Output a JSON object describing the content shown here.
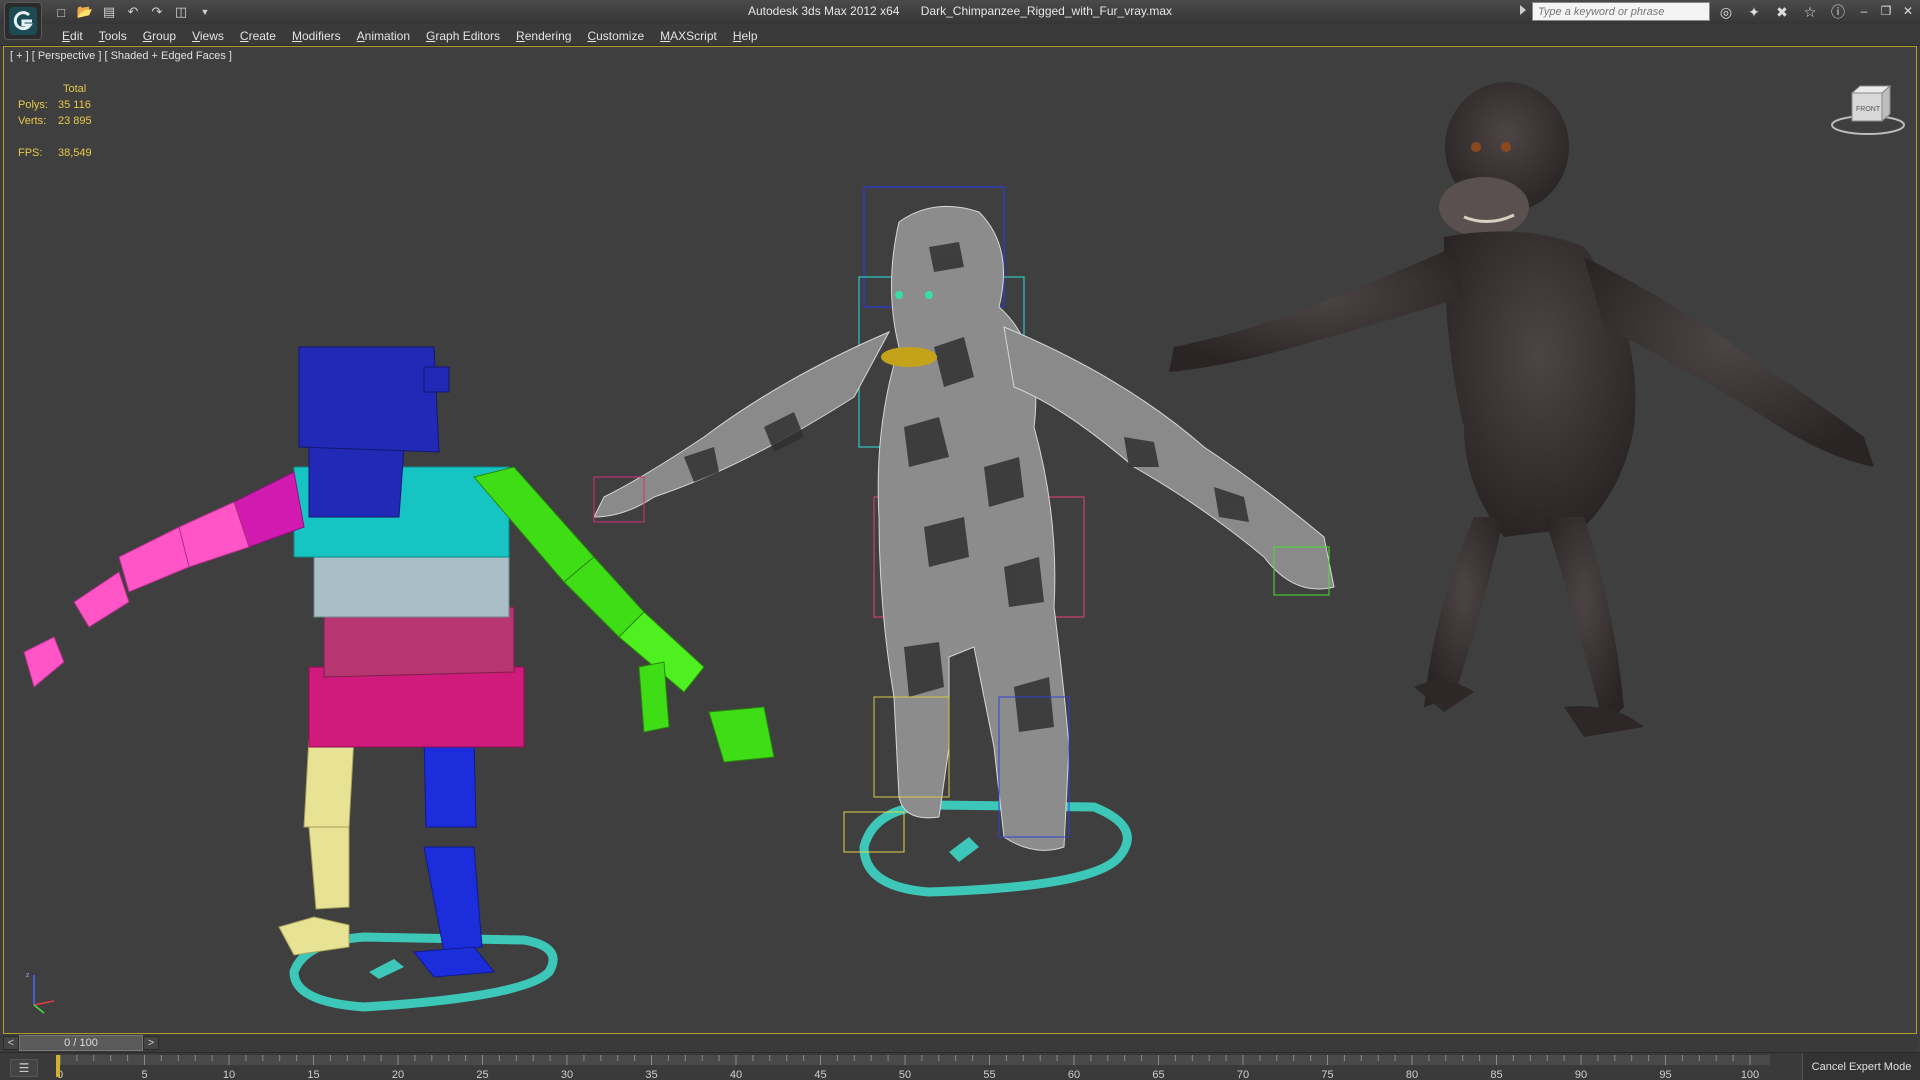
{
  "titlebar": {
    "app_name": "Autodesk 3ds Max  2012 x64",
    "file_name": "Dark_Chimpanzee_Rigged_with_Fur_vray.max",
    "search_placeholder": "Type a keyword or phrase"
  },
  "quick_access_icons": [
    "new-file-icon",
    "open-file-icon",
    "save-icon",
    "undo-icon",
    "redo-icon",
    "project-folder-icon"
  ],
  "help_tools_icons": [
    "binoculars-icon",
    "communication-center-icon",
    "favorites-icon",
    "star-icon",
    "help-icon"
  ],
  "menu": [
    "Edit",
    "Tools",
    "Group",
    "Views",
    "Create",
    "Modifiers",
    "Animation",
    "Graph Editors",
    "Rendering",
    "Customize",
    "MAXScript",
    "Help"
  ],
  "viewport": {
    "label": "[ + ] [ Perspective ] [ Shaded + Edged Faces ]",
    "stats": {
      "header": "Total",
      "polys_label": "Polys:",
      "polys_value": "35 116",
      "verts_label": "Verts:",
      "verts_value": "23 895",
      "fps_label": "FPS:",
      "fps_value": "38,549"
    },
    "viewcube_label": "FRONT"
  },
  "timeslider": {
    "prev": "<",
    "position": "0 / 100",
    "next": ">"
  },
  "trackbar": {
    "ticks": [
      0,
      5,
      10,
      15,
      20,
      25,
      30,
      35,
      40,
      45,
      50,
      55,
      60,
      65,
      70,
      75,
      80,
      85,
      90,
      95,
      100
    ]
  },
  "cancel_expert_mode": "Cancel Expert Mode",
  "colors": {
    "accent_border": "#b59c2d",
    "stats_text": "#e8c84a",
    "viewport_bg": "#3f3f3f"
  }
}
